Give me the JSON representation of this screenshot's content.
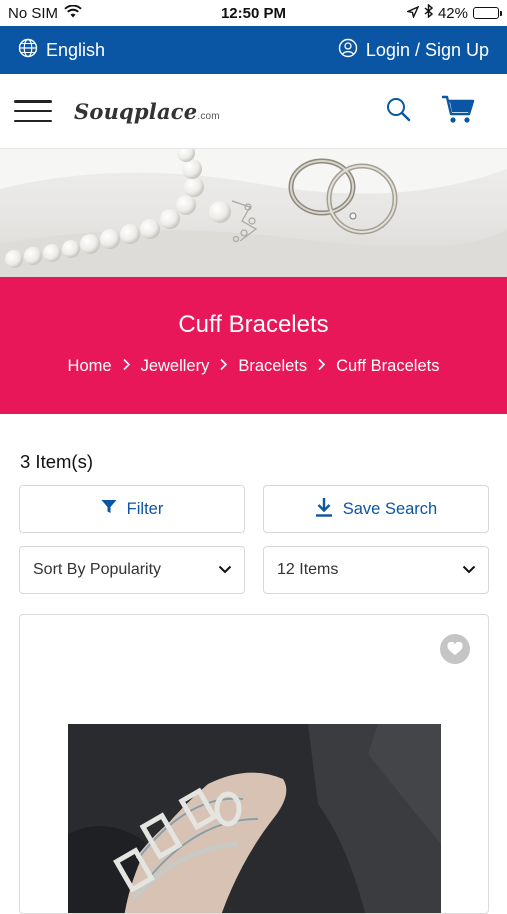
{
  "status_bar": {
    "carrier": "No SIM",
    "time": "12:50 PM",
    "battery": "42%",
    "battery_level": 0.42
  },
  "topbar": {
    "language": "English",
    "login": "Login / Sign Up"
  },
  "header": {
    "logo_text": "Souqplace",
    "logo_suffix": ".com"
  },
  "banner": {
    "title": "Cuff Bracelets",
    "breadcrumbs": [
      "Home",
      "Jewellery",
      "Bracelets",
      "Cuff Bracelets"
    ]
  },
  "listing": {
    "count": "3 Item(s)",
    "filter_label": "Filter",
    "save_search_label": "Save Search",
    "sort_value": "Sort By Popularity",
    "per_page_value": "12 Items"
  },
  "colors": {
    "brand_blue": "#0b56a4",
    "banner_pink": "#e8175a"
  }
}
